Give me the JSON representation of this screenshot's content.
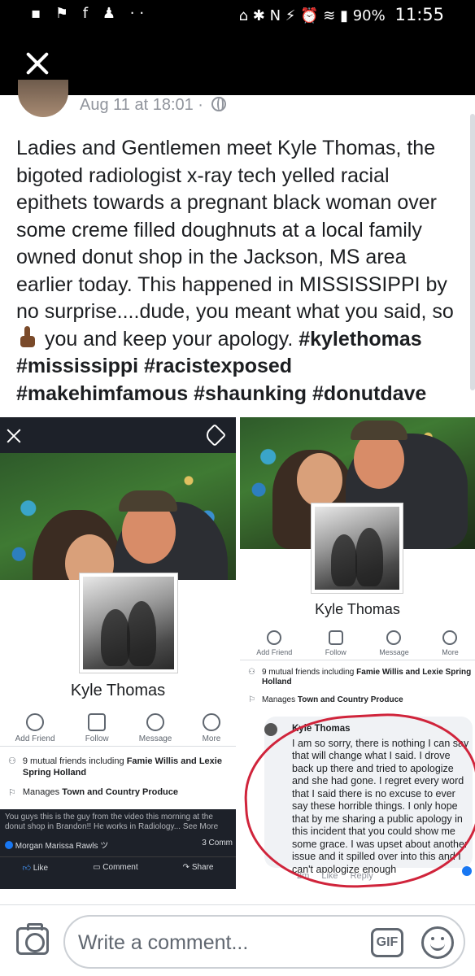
{
  "status_bar": {
    "left_icons": "▪ ⚑ f ♟ ··",
    "right_icons": "⌂ ✱ N ⚡ ⏰ ≋ ▮",
    "battery": "90%",
    "time": "11:55"
  },
  "post": {
    "timestamp": "Aug 11 at 18:01 ·",
    "text_1": "Ladies and Gentlemen meet Kyle Thomas, the bigoted radiologist x-ray tech yelled racial epithets towards a pregnant black woman over some creme filled doughnuts at a local family owned donut shop in the Jackson, MS area earlier today. This happened in MISSISSIPPI by no surprise....dude, you meant what you said, so",
    "text_2": "you and keep your apology.",
    "hashtags": [
      "#kylethomas",
      "#mississippi",
      "#racistexposed",
      "#makehimfamous",
      "#shaunking",
      "#donutdave"
    ]
  },
  "screenshot_left": {
    "name": "Kyle Thomas",
    "actions": [
      "Add Friend",
      "Follow",
      "Message",
      "More"
    ],
    "mutual": "9 mutual friends including",
    "mutual_names": "Famie Willis and Lexie Spring Holland",
    "manages_prefix": "Manages",
    "manages_page": "Town and Country Produce",
    "caption": "You guys this is the guy from the video this morning at the donut shop in Brandon!! He works in Radiology... See More",
    "commenter": "Morgan Marissa Rawls ツ",
    "comments_count": "3 Comm",
    "bottom_actions": [
      "Like",
      "Comment",
      "Share"
    ]
  },
  "screenshot_right_top": {
    "name": "Kyle Thomas",
    "actions": [
      "Add Friend",
      "Follow",
      "Message",
      "More"
    ],
    "mutual": "9 mutual friends including",
    "mutual_names": "Famie Willis and Lexie Spring Holland",
    "manages_prefix": "Manages",
    "manages_page": "Town and Country Produce"
  },
  "screenshot_right_bottom": {
    "author": "Kyle Thomas",
    "comment": "I am so sorry, there is nothing I can say that will change what I said. I drove back up there and tried to apologize and she had gone. I regret every word that I said there is no excuse to ever say these horrible things. I only hope that by me sharing a public apology in this incident that you could show me some grace. I was upset about another issue and it spilled over into this and I can't apologize enough",
    "actions": [
      "2m",
      "Like",
      "Reply"
    ]
  },
  "composer": {
    "placeholder": "Write a comment...",
    "gif": "GIF"
  },
  "colors": {
    "top_bar": "#000000",
    "text": "#1c1e21",
    "muted": "#606770",
    "highlight_circle": "#d0243b"
  }
}
